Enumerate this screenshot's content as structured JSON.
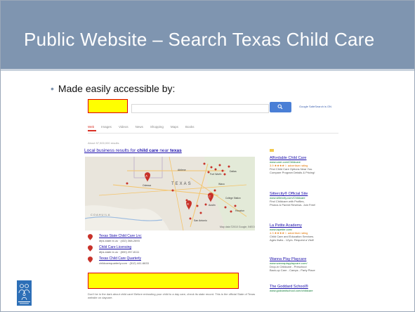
{
  "slide": {
    "title": "Public Website – Search Texas Child Care",
    "bullet": "Made easily accessible by:"
  },
  "browser": {
    "safesearch_link": "Google SafeSearch is ON",
    "tabs": [
      "Web",
      "Images",
      "Videos",
      "News",
      "Shopping",
      "Maps",
      "Books"
    ],
    "active_tab": "Web",
    "results_stats": "About 57,500,000 results",
    "local_prefix": "Local business results for ",
    "local_query1": "child care",
    "local_mid": " near ",
    "local_query2": "texas",
    "map_credit": "Map data ©2010 Google, INEGI"
  },
  "map_labels": {
    "fort_worth": "Fort Worth",
    "dallas": "Dallas",
    "texas": "TEXAS",
    "abilene": "Abilene",
    "odessa": "Odessa",
    "college_station": "College Station",
    "houston": "Houston",
    "austin": "Austin",
    "san_antonio": "San Antonio",
    "coahuila": "COAHUILA",
    "waco": "Waco"
  },
  "listings": [
    {
      "name": "Texas State Child Care Lnc",
      "sub": "dfps.state.tx.us · (432) 368-2693"
    },
    {
      "name": "Child Care Licensing",
      "sub": "dfps.state.tx.us · (830) 257-8111"
    },
    {
      "name": "Texas Child Care Quarterly",
      "sub": "childcarequarterly.com · (512) 441-6633"
    }
  ],
  "footer_text": "Don't be in the dark about child care! Before entrusting your child to a day care, check its state record. This is the official State of Texas website on daycare.",
  "ads": [
    {
      "title": "Affordable Child Care",
      "url": "www.care.com/Childcare",
      "rating": "3.9 ★★★★☆ advertiser rating",
      "desc1": "Find Child Care Options Near You.",
      "desc2": "Compare Program Details & Pricing!"
    },
    {
      "title": "Sittercity® Official Site",
      "url": "www.sittercity.com/Childcare",
      "rating": "",
      "desc1": "Find Childcare with Profiles,",
      "desc2": "Photos & Parent Reviews. Join Free!"
    },
    {
      "title": "La Petite Academy",
      "url": "www.lapetite.com/",
      "rating": "4.3 ★★★★☆ advertiser rating",
      "desc1": "Child Care and Education Services.",
      "desc2": "Ages 6wks - 12yrs. Request a Visit!"
    },
    {
      "title": "Wanna Play Playcare",
      "url": "www.wannaplayplaycare.com/",
      "rating": "",
      "desc1": "Drop-in Childcare - Preschool",
      "desc2": "Back-up Care - Camps - Party Place"
    },
    {
      "title": "The Goddard School®",
      "url": "www.goddardschool.com/childcare",
      "rating": "",
      "desc1": "",
      "desc2": ""
    }
  ],
  "colors": {
    "title_bar": "#7f95b0",
    "highlight_fill": "#ffff00",
    "highlight_border": "#e00000",
    "search_button": "#4a7fd6",
    "link": "#1a0dab",
    "map_pin": "#c8322a"
  },
  "icons": {
    "search_button": "magnifier-icon",
    "listing_pin": "map-pin-icon",
    "logo": "texas-family-services-logo"
  }
}
